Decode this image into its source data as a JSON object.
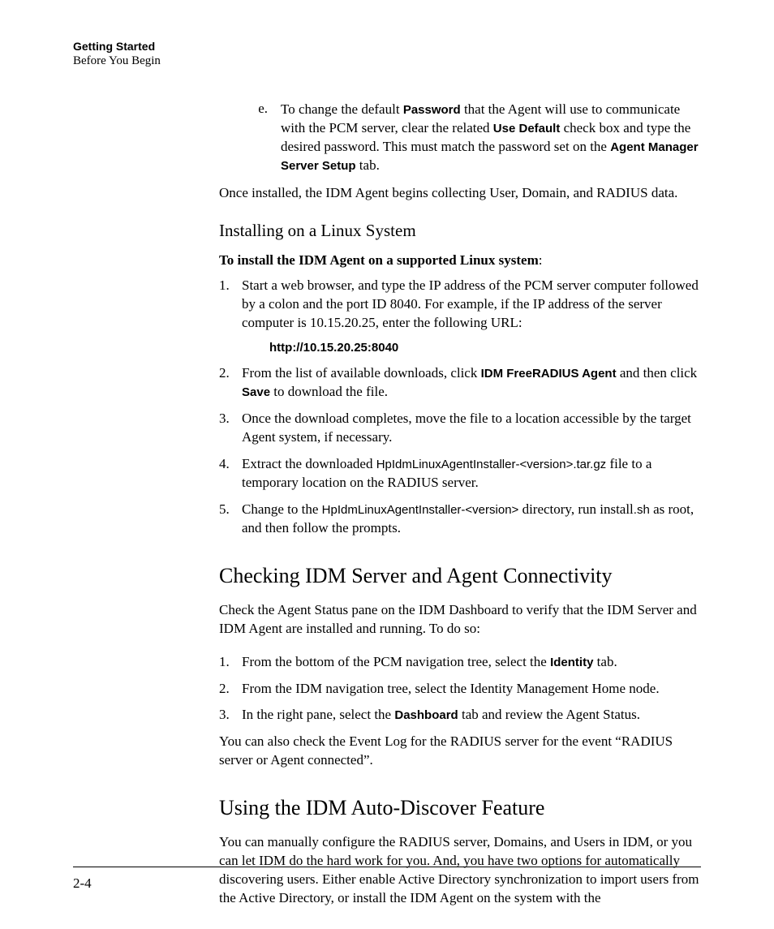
{
  "header": {
    "title": "Getting Started",
    "subtitle": "Before You Begin"
  },
  "step_e": {
    "marker": "e.",
    "t1": "To change the default ",
    "b1": "Password",
    "t2": " that the Agent will use to communicate with the PCM server, clear the related ",
    "b2": "Use Default",
    "t3": " check box and type the desired password. This must match the password set on the ",
    "b3": "Agent Manager Server Setup",
    "t4": " tab."
  },
  "post_e": "Once installed, the IDM Agent begins collecting User, Domain, and RADIUS data.",
  "linux": {
    "heading": "Installing on a Linux System",
    "intro": "To install the IDM Agent on a supported Linux system",
    "colon": ":",
    "step1": {
      "marker": "1.",
      "text": "Start a web browser, and type the IP address of the PCM server computer followed by a colon and the port ID 8040. For example, if the IP address of the server computer is 10.15.20.25, enter the following URL:"
    },
    "url": "http://10.15.20.25:8040",
    "step2": {
      "marker": "2.",
      "t1": "From the list of available downloads, click ",
      "b1": "IDM FreeRADIUS Agent",
      "t2": " and then click ",
      "b2": "Save",
      "t3": " to download the file."
    },
    "step3": {
      "marker": "3.",
      "text": "Once the download completes, move the file to a location accessible by the target Agent system, if necessary."
    },
    "step4": {
      "marker": "4.",
      "t1": "Extract the downloaded ",
      "c1": "HpIdmLinuxAgentInstaller-<version>.tar.gz",
      "t2": " file to a temporary location on the RADIUS server."
    },
    "step5": {
      "marker": "5.",
      "t1": "Change to the ",
      "c1": "HpIdmLinuxAgentInstaller-<version>",
      "t2": " directory, run install",
      "c2": ".sh",
      "t3": " as root, and then follow the prompts."
    }
  },
  "connectivity": {
    "heading": "Checking IDM Server and Agent Connectivity",
    "intro": "Check the Agent Status pane on the IDM Dashboard to verify that the IDM Server and IDM Agent are installed and running. To do so:",
    "step1": {
      "marker": "1.",
      "t1": " From the bottom of the PCM navigation tree, select the ",
      "b1": "Identity",
      "t2": " tab."
    },
    "step2": {
      "marker": "2.",
      "text": " From the IDM navigation tree, select the Identity Management Home node."
    },
    "step3": {
      "marker": "3.",
      "t1": "In the right pane, select the ",
      "b1": "Dashboard",
      "t2": " tab and review the Agent Status."
    },
    "post": "You can also check the Event Log for the RADIUS server for the event “RADIUS server or Agent connected”."
  },
  "autodiscover": {
    "heading": "Using the IDM Auto-Discover Feature",
    "para": "You can manually configure the RADIUS server, Domains, and Users in IDM, or you can let IDM do the hard work for you. And, you have two options for automatically discovering users. Either enable Active Directory synchronization to import users from the Active Directory, or install the IDM Agent on the system with the"
  },
  "footer": {
    "page": "2-4"
  }
}
